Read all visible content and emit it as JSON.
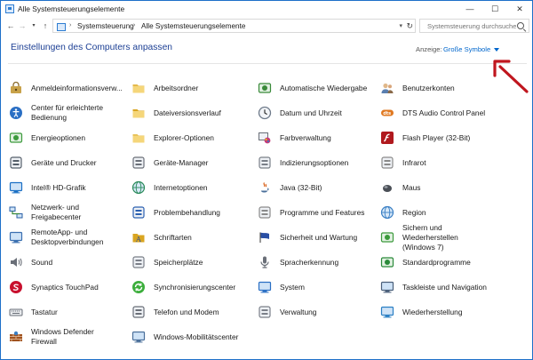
{
  "window": {
    "title": "Alle Systemsteuerungselemente",
    "controls": [
      "—",
      "☐",
      "✕"
    ]
  },
  "address": {
    "crumbs": [
      "Systemsteuerung",
      "Alle Systemsteuerungselemente"
    ],
    "search_placeholder": "Systemsteuerung durchsuchen"
  },
  "header": {
    "title": "Einstellungen des Computers anpassen",
    "view_label": "Anzeige:",
    "view_value": "Große Symbole"
  },
  "colors": {
    "title_blue": "#1c3f94",
    "link_blue": "#0066cc",
    "annotation_red": "#c0161e"
  },
  "items": [
    {
      "label": "Anmeldeinformationsverw...",
      "icon": "credential-manager-icon",
      "color": "#c8a24a"
    },
    {
      "label": "Arbeitsordner",
      "icon": "work-folders-icon",
      "color": "#e4b94a"
    },
    {
      "label": "Automatische Wiedergabe",
      "icon": "autoplay-icon",
      "color": "#3a8a3a"
    },
    {
      "label": "Benutzerkonten",
      "icon": "user-accounts-icon",
      "color": "#5a7fb0"
    },
    {
      "label": "Center für erleichterte\nBedienung",
      "icon": "ease-of-access-icon",
      "color": "#2a6fc4"
    },
    {
      "label": "Dateiversionsverlauf",
      "icon": "file-history-icon",
      "color": "#d9a521"
    },
    {
      "label": "Datum und Uhrzeit",
      "icon": "clock-icon",
      "color": "#6e7a8a"
    },
    {
      "label": "DTS Audio Control Panel",
      "icon": "dts-audio-icon",
      "color": "#e07820"
    },
    {
      "label": "Energieoptionen",
      "icon": "power-options-icon",
      "color": "#3c9a3c"
    },
    {
      "label": "Explorer-Optionen",
      "icon": "explorer-options-icon",
      "color": "#e8c35a"
    },
    {
      "label": "Farbverwaltung",
      "icon": "color-management-icon",
      "color": "#c43a7a"
    },
    {
      "label": "Flash Player (32-Bit)",
      "icon": "flash-player-icon",
      "color": "#b0191e"
    },
    {
      "label": "Geräte und Drucker",
      "icon": "devices-printers-icon",
      "color": "#555f6a"
    },
    {
      "label": "Geräte-Manager",
      "icon": "device-manager-icon",
      "color": "#6a6f78"
    },
    {
      "label": "Indizierungsoptionen",
      "icon": "indexing-options-icon",
      "color": "#7a8088"
    },
    {
      "label": "Infrarot",
      "icon": "infrared-icon",
      "color": "#8a8a8a"
    },
    {
      "label": "Intel® HD-Grafik",
      "icon": "intel-graphics-icon",
      "color": "#1a6fc4"
    },
    {
      "label": "Internetoptionen",
      "icon": "internet-options-icon",
      "color": "#2a8a5a"
    },
    {
      "label": "Java (32-Bit)",
      "icon": "java-icon",
      "color": "#d9641e"
    },
    {
      "label": "Maus",
      "icon": "mouse-icon",
      "color": "#4a4f56"
    },
    {
      "label": "Netzwerk- und\nFreigabecenter",
      "icon": "network-center-icon",
      "color": "#2a5fa4"
    },
    {
      "label": "Problembehandlung",
      "icon": "troubleshooting-icon",
      "color": "#2a5fb0"
    },
    {
      "label": "Programme und Features",
      "icon": "programs-features-icon",
      "color": "#8a8a8a"
    },
    {
      "label": "Region",
      "icon": "region-icon",
      "color": "#3a7fc4"
    },
    {
      "label": "RemoteApp- und\nDesktopverbindungen",
      "icon": "remoteapp-icon",
      "color": "#3a6fb0"
    },
    {
      "label": "Schriftarten",
      "icon": "fonts-icon",
      "color": "#d9a521"
    },
    {
      "label": "Sicherheit und Wartung",
      "icon": "security-maintenance-icon",
      "color": "#2a4fa4"
    },
    {
      "label": "Sichern und\nWiederherstellen\n(Windows 7)",
      "icon": "backup-restore-icon",
      "color": "#3c9a3c"
    },
    {
      "label": "Sound",
      "icon": "sound-icon",
      "color": "#6a6f78"
    },
    {
      "label": "Speicherplätze",
      "icon": "storage-spaces-icon",
      "color": "#7a7f88"
    },
    {
      "label": "Spracherkennung",
      "icon": "speech-recognition-icon",
      "color": "#6a6f78"
    },
    {
      "label": "Standardprogramme",
      "icon": "default-programs-icon",
      "color": "#2a8a3a"
    },
    {
      "label": "Synaptics TouchPad",
      "icon": "synaptics-touchpad-icon",
      "color": "#c8102e"
    },
    {
      "label": "Synchronisierungscenter",
      "icon": "sync-center-icon",
      "color": "#3cae3c"
    },
    {
      "label": "System",
      "icon": "system-icon",
      "color": "#2a6fc4"
    },
    {
      "label": "Taskleiste und Navigation",
      "icon": "taskbar-icon",
      "color": "#4a5f7a"
    },
    {
      "label": "Tastatur",
      "icon": "keyboard-icon",
      "color": "#6a6f78"
    },
    {
      "label": "Telefon und Modem",
      "icon": "phone-modem-icon",
      "color": "#6a6f78"
    },
    {
      "label": "Verwaltung",
      "icon": "administrative-tools-icon",
      "color": "#7a7f88"
    },
    {
      "label": "Wiederherstellung",
      "icon": "recovery-icon",
      "color": "#2a7fc4"
    },
    {
      "label": "Windows Defender\nFirewall",
      "icon": "firewall-icon",
      "color": "#a0521e"
    },
    {
      "label": "Windows-Mobilitätscenter",
      "icon": "mobility-center-icon",
      "color": "#4a6f9a"
    }
  ]
}
